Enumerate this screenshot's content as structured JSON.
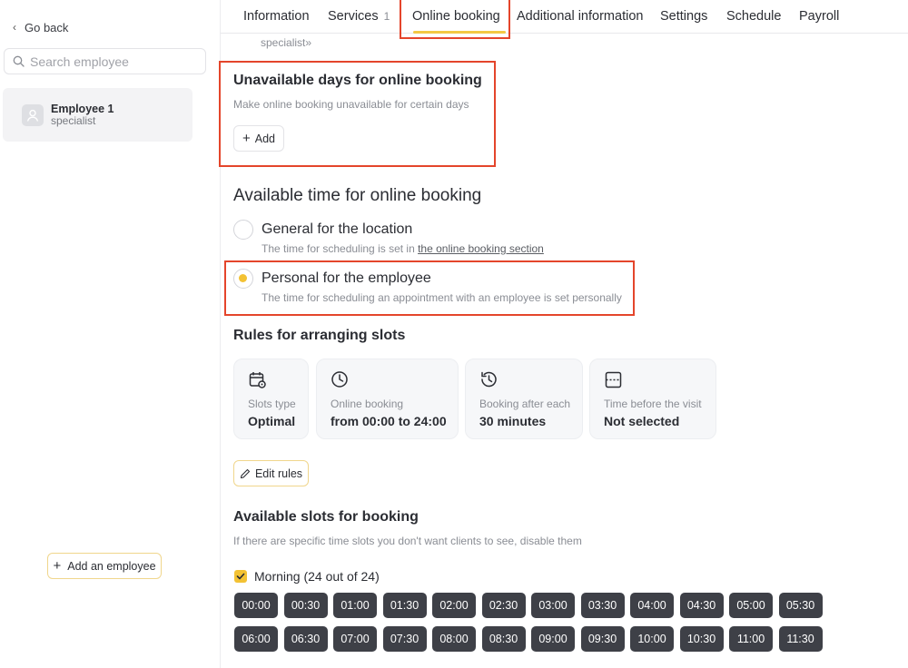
{
  "sidebar": {
    "go_back": "Go back",
    "search_placeholder": "Search employee",
    "employee": {
      "name": "Employee 1",
      "role": "specialist"
    },
    "add_employee": "Add an employee"
  },
  "tabs": [
    {
      "label": "Information"
    },
    {
      "label": "Services",
      "count": "1"
    },
    {
      "label": "Online booking"
    },
    {
      "label": "Additional information"
    },
    {
      "label": "Settings"
    },
    {
      "label": "Schedule"
    },
    {
      "label": "Payroll"
    }
  ],
  "active_tab": "Online booking",
  "cut_text": "specialist»",
  "unavailable": {
    "title": "Unavailable days for online booking",
    "subtitle": "Make online booking unavailable for certain days",
    "add_label": "Add"
  },
  "available_time": {
    "title": "Available time for online booking",
    "options": [
      {
        "label": "General for the location",
        "desc_prefix": "The time for scheduling is set in ",
        "desc_link": "the online booking section",
        "selected": false
      },
      {
        "label": "Personal for the employee",
        "desc": "The time for scheduling an appointment with an employee is set personally",
        "selected": true
      }
    ]
  },
  "rules": {
    "title": "Rules for arranging slots",
    "cards": [
      {
        "icon": "calendar-settings-icon",
        "label": "Slots type",
        "value": "Optimal"
      },
      {
        "icon": "clock-icon",
        "label": "Online booking",
        "value": "from 00:00 to 24:00"
      },
      {
        "icon": "history-icon",
        "label": "Booking after each",
        "value": "30 minutes"
      },
      {
        "icon": "time-gap-icon",
        "label": "Time before the visit",
        "value": "Not selected"
      }
    ],
    "edit_label": "Edit rules"
  },
  "slots": {
    "title": "Available slots for booking",
    "subtitle": "If there are specific time slots you don't want clients to see, disable them",
    "group_label": "Morning (24 out of 24)",
    "group_checked": true,
    "times": [
      "00:00",
      "00:30",
      "01:00",
      "01:30",
      "02:00",
      "02:30",
      "03:00",
      "03:30",
      "04:00",
      "04:30",
      "05:00",
      "05:30",
      "06:00",
      "06:30",
      "07:00",
      "07:30",
      "08:00",
      "08:30",
      "09:00",
      "09:30",
      "10:00",
      "10:30",
      "11:00",
      "11:30"
    ]
  },
  "colors": {
    "accent": "#f3c234",
    "highlight": "#e4452b",
    "slot_bg": "#3e4047"
  }
}
